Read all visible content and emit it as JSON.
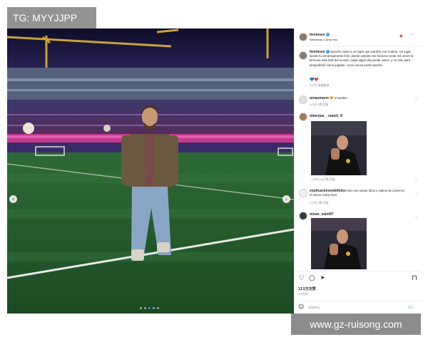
{
  "watermarks": {
    "top": "TG: MYYJJPP",
    "bottom": "www.gz-ruisong.com"
  },
  "photo": {
    "prev_icon": "‹",
    "next_icon": "›",
    "dot_count": 5,
    "active_dot": 2
  },
  "header": {
    "username": "leomessi",
    "verified_icon": "✓",
    "location": "Barcelona, Camp Nou",
    "more_icon": "···",
    "badge_icon": "◆"
  },
  "caption": {
    "username": "leomessi",
    "verified_icon": "✓",
    "text": "Abrazhe volvé a un lugar que extraño con el alma. Un lugar donde fui inmensamente feliz, donde ustedes me hicieron sentir mil veces la persona más feliz del mundo. Ojalá algún día pueda volver, y no solo para despedirme como jugador, como nunca pude hacerlo...",
    "emojis": "💙❤️",
    "time": "4小时",
    "meta_extra": "查看翻译"
  },
  "comments": [
    {
      "username": "arnaumann",
      "text": "🧡 a hombre",
      "time": "4小时",
      "likes": "4赞",
      "reply": "回复"
    },
    {
      "username": "mbenjue__maick_8",
      "text": "",
      "time": "1小时",
      "likes": "5.8万赞",
      "reply": "回复"
    },
    {
      "username": "explicacionesdefotos",
      "text": "Esto son varias fotos y videos de Lionel en el nuevo Camp Nou",
      "time": "2小时",
      "likes": "3赞",
      "reply": "回复"
    },
    {
      "username": "miran_saint97",
      "text": "",
      "time": "",
      "likes": "",
      "reply": ""
    }
  ],
  "actions": {
    "like_icon": "♡",
    "comment_icon": "○",
    "share_icon": "➤",
    "save_icon": "⊓",
    "likes_count": "13.5万次赞",
    "time_ago": "4小时前"
  },
  "add_comment": {
    "emoji_icon": "☺",
    "placeholder": "添加评论…",
    "post_label": "发布"
  },
  "colors": {
    "accent": "#3897f0",
    "text": "#262626",
    "muted": "#8e8e8e"
  }
}
